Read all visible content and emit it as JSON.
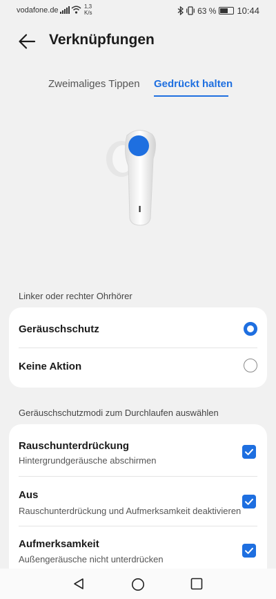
{
  "status_bar": {
    "carrier": "vodafone.de",
    "speed_value": "1,3",
    "speed_unit": "K/s",
    "battery": "63 %",
    "time": "10:44"
  },
  "header": {
    "title": "Verknüpfungen"
  },
  "tabs": [
    {
      "label": "Zweimaliges Tippen",
      "active": false
    },
    {
      "label": "Gedrückt halten",
      "active": true
    }
  ],
  "section1": {
    "heading": "Linker oder rechter Ohrhörer",
    "options": [
      {
        "label": "Geräuschschutz",
        "selected": true
      },
      {
        "label": "Keine Aktion",
        "selected": false
      }
    ]
  },
  "section2": {
    "heading": "Geräuschschutzmodi zum Durchlaufen auswählen",
    "modes": [
      {
        "label": "Rauschunterdrückung",
        "desc": "Hintergrundgeräusche abschirmen",
        "checked": true
      },
      {
        "label": "Aus",
        "desc": "Rauschunterdrückung und Aufmerksamkeit deaktivieren",
        "checked": true
      },
      {
        "label": "Aufmerksamkeit",
        "desc": "Außengeräusche nicht unterdrücken",
        "checked": true
      }
    ]
  },
  "colors": {
    "accent": "#1e6fe0",
    "background": "#f1f1f1"
  },
  "icons": [
    "back-arrow-icon",
    "signal-icon",
    "wifi-icon",
    "bluetooth-icon",
    "vibrate-icon",
    "battery-icon",
    "radio-icon",
    "checkbox-icon",
    "nav-back-icon",
    "nav-home-icon",
    "nav-recents-icon"
  ]
}
